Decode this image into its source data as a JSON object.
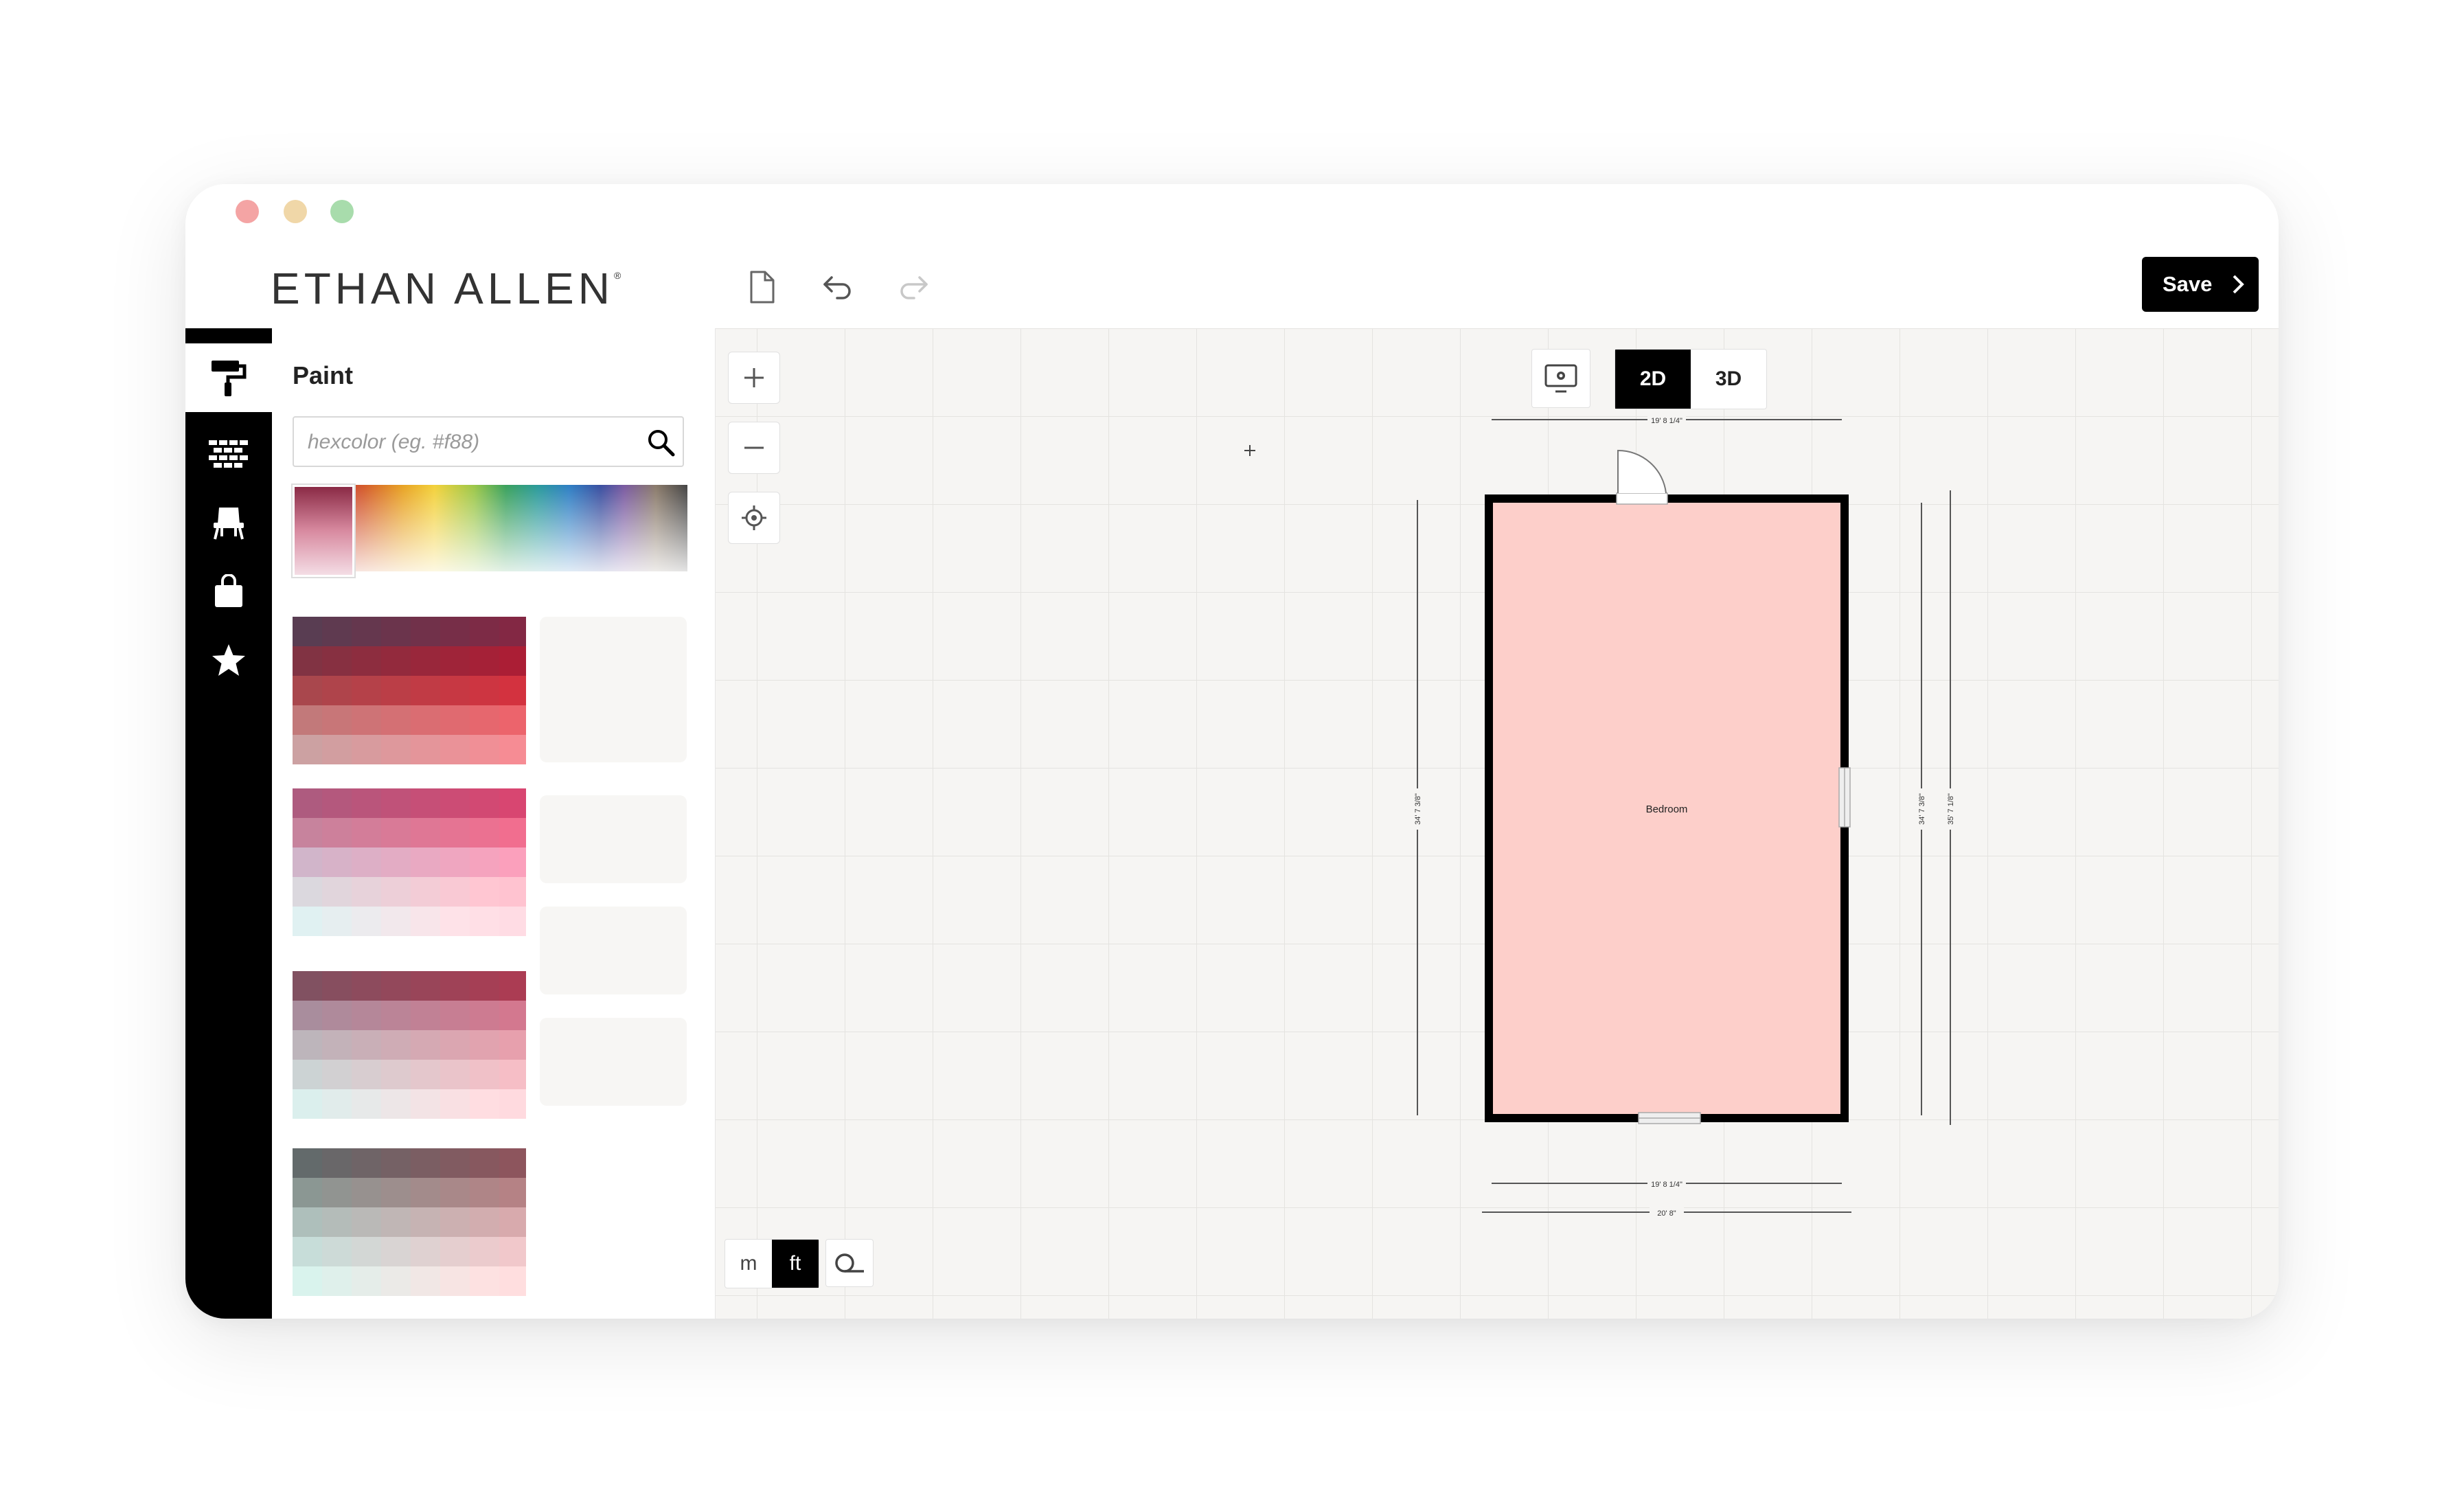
{
  "window": {
    "traffic_lights": [
      {
        "name": "close",
        "color": "#f4a4a4"
      },
      {
        "name": "minimize",
        "color": "#f0d7a8"
      },
      {
        "name": "maximize",
        "color": "#a8dcac"
      }
    ]
  },
  "header": {
    "brand": "ETHAN ALLEN",
    "brand_mark": "®",
    "icons": [
      "new-file-icon",
      "undo-icon",
      "redo-icon"
    ],
    "save_label": "Save"
  },
  "rail": {
    "items": [
      {
        "name": "paint",
        "icon": "paint-roller-icon",
        "active": true
      },
      {
        "name": "floors",
        "icon": "brick-pattern-icon",
        "active": false
      },
      {
        "name": "furniture",
        "icon": "chair-icon",
        "active": false
      },
      {
        "name": "shop",
        "icon": "shopping-bag-icon",
        "active": false
      },
      {
        "name": "favorites",
        "icon": "star-icon",
        "active": false
      }
    ]
  },
  "paint_panel": {
    "title": "Paint",
    "search_placeholder": "hexcolor (eg. #f88)",
    "search_value": ""
  },
  "canvas": {
    "view_modes": [
      "2D",
      "3D"
    ],
    "active_view": "2D",
    "units": [
      "m",
      "ft"
    ],
    "active_unit": "ft",
    "room": {
      "name": "Bedroom",
      "fill_color": "#fdcfca",
      "dim_top": "19' 8 1/4\"",
      "dim_bottom_inner": "19' 8 1/4\"",
      "dim_bottom_outer": "20' 8\"",
      "dim_left": "34' 7 3/8\"",
      "dim_right_inner": "34' 7 3/8\"",
      "dim_right_outer": "35' 7 1/8\""
    }
  },
  "colors": {
    "accent": "#000000",
    "canvas_bg": "#f6f5f3",
    "grid": "#e4e3e0",
    "wall": "#000000"
  }
}
